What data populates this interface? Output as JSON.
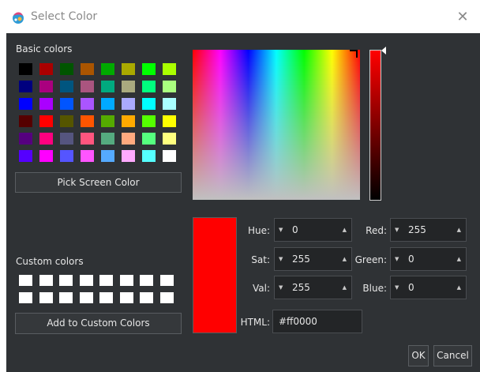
{
  "window": {
    "title": "Select Color",
    "close_icon": "close-icon"
  },
  "basic_colors": {
    "label": "Basic colors",
    "rows": [
      [
        "#000000",
        "#aa0000",
        "#005500",
        "#aa5500",
        "#00aa00",
        "#aaaa00",
        "#00ff00",
        "#aaff00"
      ],
      [
        "#00007f",
        "#aa007f",
        "#00557f",
        "#aa557f",
        "#00aa7f",
        "#aaaa7f",
        "#00ff7f",
        "#aaff7f"
      ],
      [
        "#0000ff",
        "#aa00ff",
        "#0055ff",
        "#aa55ff",
        "#00aaff",
        "#aaaaff",
        "#00ffff",
        "#aaffff"
      ],
      [
        "#550000",
        "#ff0000",
        "#555500",
        "#ff5500",
        "#55aa00",
        "#ffaa00",
        "#55ff00",
        "#ffff00"
      ],
      [
        "#55007f",
        "#ff007f",
        "#55557f",
        "#ff557f",
        "#55aa7f",
        "#ffaa7f",
        "#55ff7f",
        "#ffff7f"
      ],
      [
        "#5500ff",
        "#ff00ff",
        "#5555ff",
        "#ff55ff",
        "#55aaff",
        "#ffaaff",
        "#55ffff",
        "#ffffff"
      ]
    ]
  },
  "pick_screen_label": "Pick Screen Color",
  "custom_colors": {
    "label": "Custom colors",
    "rows": [
      [
        "#ffffff",
        "#ffffff",
        "#ffffff",
        "#ffffff",
        "#ffffff",
        "#ffffff",
        "#ffffff",
        "#ffffff"
      ],
      [
        "#ffffff",
        "#ffffff",
        "#ffffff",
        "#ffffff",
        "#ffffff",
        "#ffffff",
        "#ffffff",
        "#ffffff"
      ]
    ]
  },
  "add_custom_label": "Add to Custom Colors",
  "current_color": "#ff0000",
  "fields": {
    "hue": {
      "label": "Hue:",
      "value": "0"
    },
    "sat": {
      "label": "Sat:",
      "value": "255"
    },
    "val": {
      "label": "Val:",
      "value": "255"
    },
    "red": {
      "label": "Red:",
      "value": "255"
    },
    "green": {
      "label": "Green:",
      "value": "0"
    },
    "blue": {
      "label": "Blue:",
      "value": "0"
    },
    "html": {
      "label": "HTML:",
      "value": "#ff0000"
    }
  },
  "buttons": {
    "ok": "OK",
    "cancel": "Cancel"
  },
  "colors": {
    "dialog_background": "#2f3235",
    "field_background": "#232527",
    "text": "#e6e6e6"
  }
}
